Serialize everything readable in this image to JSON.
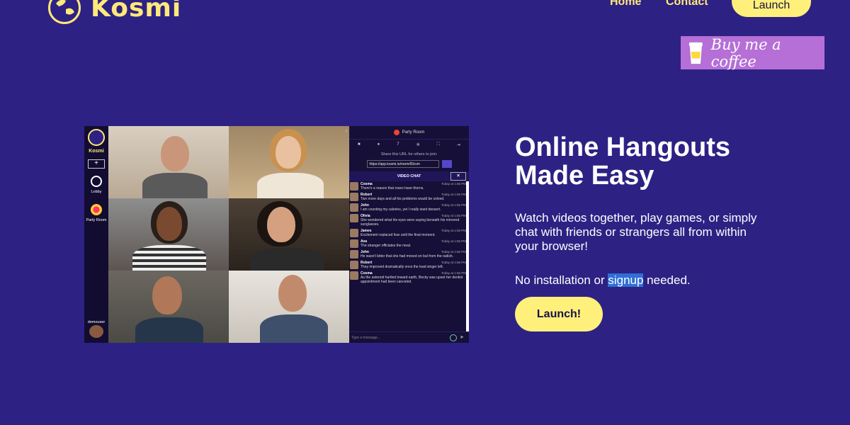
{
  "header": {
    "brand": "Kosmi",
    "nav": {
      "home": "Home",
      "contact": "Contact",
      "launch": "Launch"
    }
  },
  "coffee": {
    "label": "Buy me a coffee"
  },
  "preview": {
    "sidebar": {
      "brand": "Kosmi",
      "plus": "+",
      "lobby": "Lobby",
      "room": "Party Room",
      "user": "demouser"
    },
    "panel": {
      "room_title": "Party Room",
      "user_count": "7",
      "share_text": "Share this URL for others to join:",
      "url": "https://app.kosmi.io/room/ll3cvm",
      "chat_title": "VIDEO CHAT",
      "input_placeholder": "Type a message...",
      "messages": [
        {
          "name": "Cosma",
          "time": "Today at 1:56 PM",
          "text": "There's a reason that roses have thorns."
        },
        {
          "name": "Robert",
          "time": "Today at 1:56 PM",
          "text": "Two more days and all his problems would be solved."
        },
        {
          "name": "John",
          "time": "Today at 1:56 PM",
          "text": "I am counting my calories, yet I really want dessert."
        },
        {
          "name": "Olivia",
          "time": "Today at 1:56 PM",
          "text": "She wondered what his eyes were saying beneath his mirrored sunglasses."
        },
        {
          "name": "James",
          "time": "Today at 1:56 PM",
          "text": "Excitement replaced fear until the final moment."
        },
        {
          "name": "Ava",
          "time": "Today at 1:56 PM",
          "text": "The stranger officiates the meal."
        },
        {
          "name": "John",
          "time": "Today at 1:56 PM",
          "text": "He wasn't bitter that she had moved on but from the radish."
        },
        {
          "name": "Robert",
          "time": "Today at 1:56 PM",
          "text": "They improved dramatically once the lead singer left."
        },
        {
          "name": "Cosma",
          "time": "Today at 1:56 PM",
          "text": "As the asteroid hurtled toward earth, Becky was upset her dentist appointment had been canceled."
        }
      ]
    }
  },
  "hero": {
    "title_line1": "Online Hangouts",
    "title_line2": "Made Easy",
    "description": "Watch videos together, play games, or simply chat with friends or strangers all from within your browser!",
    "note_before": "No installation or ",
    "note_highlight": "signup",
    "note_after": " needed.",
    "launch": "Launch!"
  },
  "colors": {
    "background": "#2e2184",
    "accent_yellow": "#fff07c",
    "coffee_purple": "#b56fd6",
    "selection": "#2f6fd6"
  }
}
